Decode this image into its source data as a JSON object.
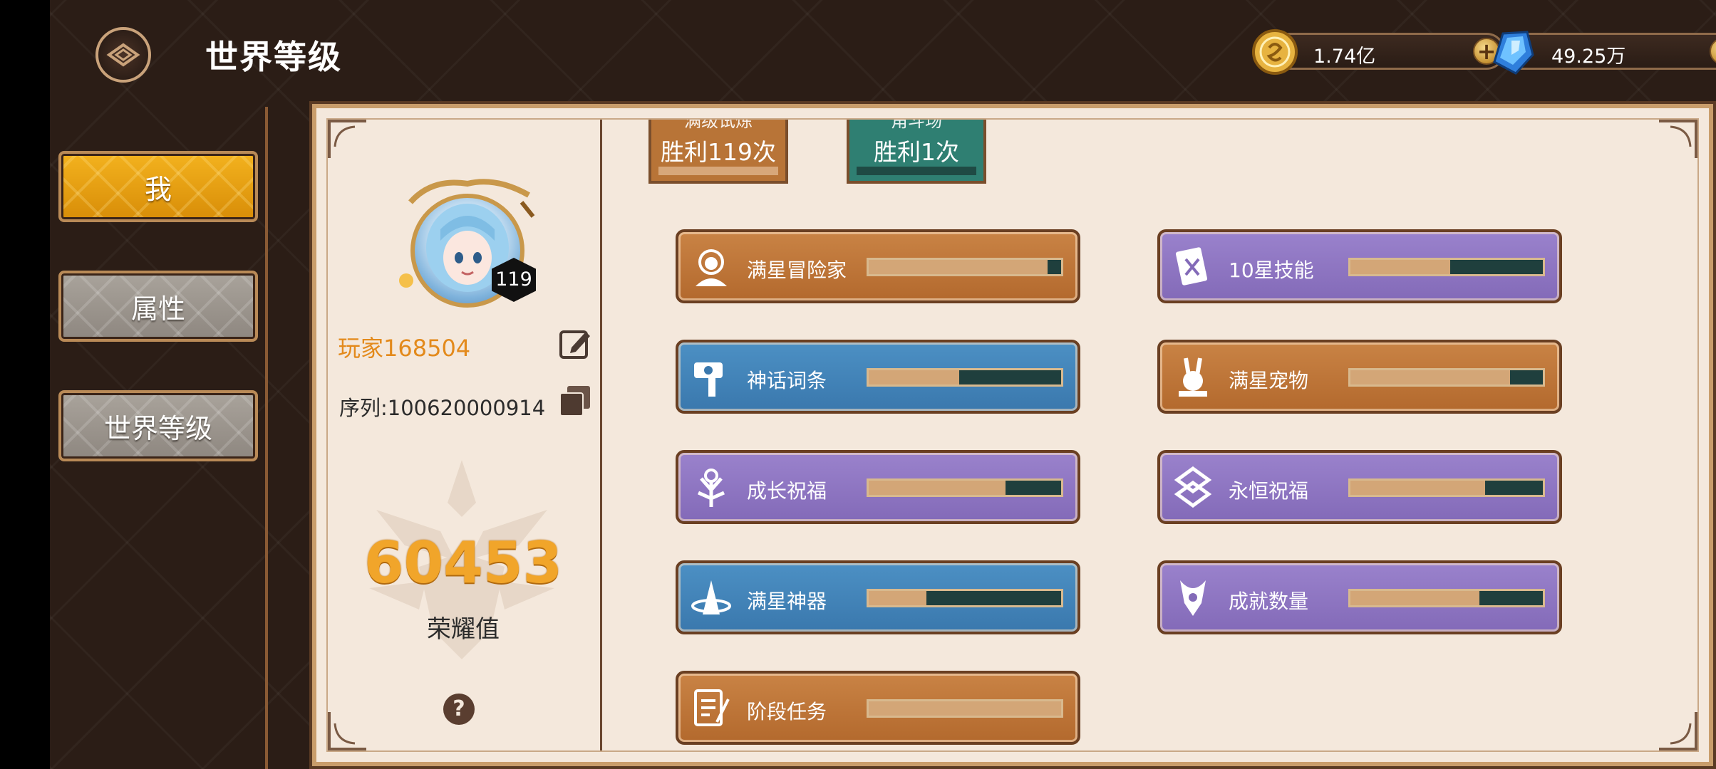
{
  "header": {
    "title": "世界等级",
    "currencies": [
      {
        "name": "gold",
        "value": "1.74亿"
      },
      {
        "name": "gem",
        "value": "49.25万"
      }
    ]
  },
  "nav": [
    {
      "label": "我",
      "active": true
    },
    {
      "label": "属性",
      "active": false
    },
    {
      "label": "世界等级",
      "active": false
    }
  ],
  "profile": {
    "name": "玩家168504",
    "serial": "序列:100620000914",
    "level": "119",
    "honor_value": "60453",
    "honor_label": "荣耀值"
  },
  "trials": [
    {
      "title": "满级试炼",
      "result": "胜利119次",
      "color": "#b87437"
    },
    {
      "title": "角斗场",
      "result": "胜利1次",
      "color": "#2f7f72"
    }
  ],
  "stats": [
    {
      "label": "满星冒险家",
      "icon": "adventurer-icon",
      "theme": "orange",
      "progress": 0.93
    },
    {
      "label": "10星技能",
      "icon": "skill-book-icon",
      "theme": "purple",
      "progress": 0.52
    },
    {
      "label": "神话词条",
      "icon": "hammer-icon",
      "theme": "blue",
      "progress": 0.47
    },
    {
      "label": "满星宠物",
      "icon": "pet-icon",
      "theme": "orange",
      "progress": 0.83
    },
    {
      "label": "成长祝福",
      "icon": "growth-tree-icon",
      "theme": "purple",
      "progress": 0.71
    },
    {
      "label": "永恒祝福",
      "icon": "eternal-knot-icon",
      "theme": "purple",
      "progress": 0.7
    },
    {
      "label": "满星神器",
      "icon": "artifact-icon",
      "theme": "blue",
      "progress": 0.3
    },
    {
      "label": "成就数量",
      "icon": "achievement-icon",
      "theme": "purple",
      "progress": 0.67
    },
    {
      "label": "阶段任务",
      "icon": "quest-scroll-icon",
      "theme": "orange",
      "progress": 1.0
    }
  ]
}
